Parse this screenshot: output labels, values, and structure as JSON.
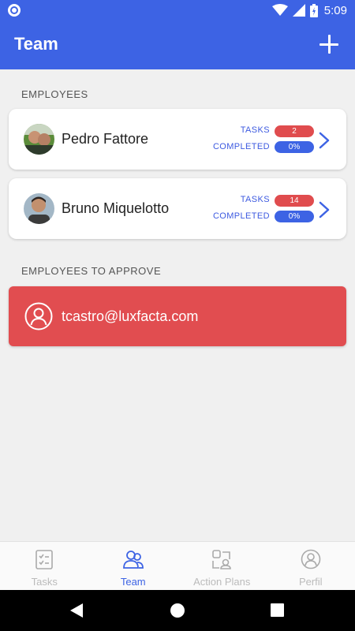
{
  "status_bar": {
    "time": "5:09"
  },
  "app_bar": {
    "title": "Team"
  },
  "sections": {
    "employees": "EMPLOYEES",
    "to_approve": "EMPLOYEES TO APPROVE"
  },
  "employees": [
    {
      "name": "Pedro Fattore",
      "tasks_label": "TASKS",
      "tasks": "2",
      "completed_label": "COMPLETED",
      "completed": "0%"
    },
    {
      "name": "Bruno Miquelotto",
      "tasks_label": "TASKS",
      "tasks": "14",
      "completed_label": "COMPLETED",
      "completed": "0%"
    }
  ],
  "pending": [
    {
      "email": "tcastro@luxfacta.com"
    }
  ],
  "bottom_nav": [
    {
      "label": "Tasks",
      "icon": "checklist-icon",
      "active": false
    },
    {
      "label": "Team",
      "icon": "team-icon",
      "active": true
    },
    {
      "label": "Action Plans",
      "icon": "action-plans-icon",
      "active": false
    },
    {
      "label": "Perfil",
      "icon": "profile-icon",
      "active": false
    }
  ],
  "colors": {
    "primary": "#3d63e4",
    "danger": "#e14d50",
    "background": "#f0f0f0"
  }
}
